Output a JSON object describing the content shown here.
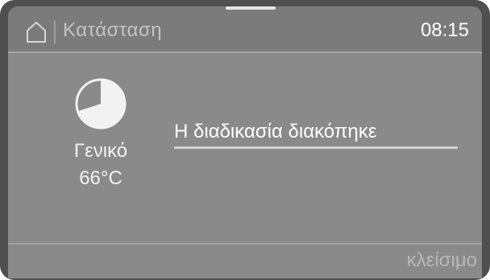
{
  "header": {
    "title": "Κατάσταση",
    "time": "08:15",
    "home_icon": "home-icon"
  },
  "program": {
    "name": "Γενικό",
    "temperature": "66°C",
    "progress_icon": "progress-pie-icon",
    "progress_fraction": 0.7
  },
  "status": {
    "message": "Η διαδικασία διακόπηκε"
  },
  "footer": {
    "close_label": "κλείσιμο"
  },
  "colors": {
    "screen_bg": "#8a8a8a",
    "header_bg": "#7b7b7b",
    "frame": "#4f4f4f",
    "text_primary": "#ffffff",
    "text_muted": "#c3c3c3"
  }
}
